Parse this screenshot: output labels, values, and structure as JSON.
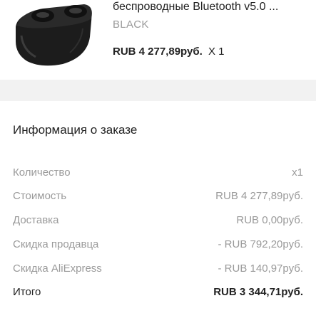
{
  "product": {
    "image_icon": "wireless-earbuds-case-image",
    "title": "беспроводные Bluetooth v5.0 ...",
    "variant": "BLACK",
    "price": "RUB 4 277,89руб.",
    "quantity": "X 1"
  },
  "order_info": {
    "title": "Информация о заказе",
    "rows": [
      {
        "label": "Количество",
        "value": "x1"
      },
      {
        "label": "Стоимость",
        "value": "RUB 4 277,89руб."
      },
      {
        "label": "Доставка",
        "value": "RUB 0,00руб."
      },
      {
        "label": "Скидка продавца",
        "value": "- RUB 792,20руб."
      },
      {
        "label": "Скидка AliExpress",
        "value": "- RUB 140,97руб."
      }
    ],
    "total": {
      "label": "Итого",
      "value": "RUB 3 344,71руб."
    }
  },
  "colors": {
    "text_primary": "#222222",
    "text_secondary": "#9a9a9a",
    "section_gap": "#f2f2f2",
    "product_dark": "#1c1c1c"
  }
}
